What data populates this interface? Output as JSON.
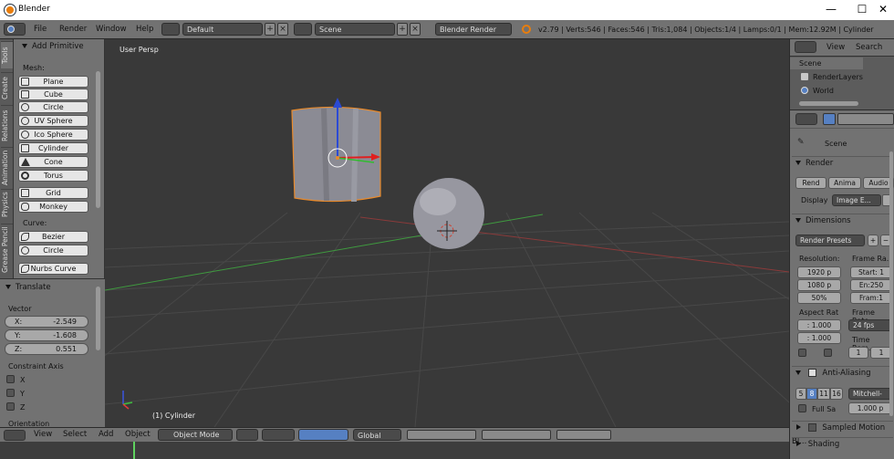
{
  "window": {
    "title": "Blender",
    "minimize": "—",
    "maximize": "☐",
    "close": "✕"
  },
  "infobar": {
    "menus": [
      "File",
      "Render",
      "Window",
      "Help"
    ],
    "layout": "Default",
    "scene": "Scene",
    "engine": "Blender Render",
    "stats": "v2.79 | Verts:546 | Faces:546 | Tris:1,084 | Objects:1/4 | Lamps:0/1 | Mem:12.92M | Cylinder"
  },
  "toolshelf": {
    "tabs": [
      "Tools",
      "Create",
      "Relations",
      "Animation",
      "Physics",
      "Grease Pencil"
    ],
    "panel_title": "Add Primitive",
    "mesh_label": "Mesh:",
    "mesh_items": [
      "Plane",
      "Cube",
      "Circle",
      "UV Sphere",
      "Ico Sphere",
      "Cylinder",
      "Cone",
      "Torus",
      "Grid",
      "Monkey"
    ],
    "curve_label": "Curve:",
    "curve_items": [
      "Bezier",
      "Circle",
      "Nurbs Curve"
    ]
  },
  "operator": {
    "title": "Translate",
    "vector_label": "Vector",
    "x": "X:",
    "x_val": "-2.549",
    "y": "Y:",
    "y_val": "-1.608",
    "z": "Z:",
    "z_val": "0.551",
    "constraint_label": "Constraint Axis",
    "cx": "X",
    "cy": "Y",
    "cz": "Z",
    "orientation": "Orientation"
  },
  "viewport": {
    "view_label": "User Persp",
    "object_label": "(1) Cylinder"
  },
  "bottombar": {
    "menus": [
      "View",
      "Select",
      "Add",
      "Object"
    ],
    "mode": "Object Mode",
    "orientation": "Global"
  },
  "outliner": {
    "view": "View",
    "search": "Search",
    "items": [
      "Scene",
      "RenderLayers",
      "World"
    ]
  },
  "properties": {
    "context": "Scene",
    "render_header": "Render",
    "render_btns": [
      "Rend",
      "Anima",
      "Audio"
    ],
    "display_label": "Display",
    "display_value": "Image E...",
    "dimensions_header": "Dimensions",
    "presets": "Render Presets",
    "resolution_label": "Resolution:",
    "res_x": "1920 p",
    "res_y": "1080 p",
    "res_pct": "50%",
    "frame_range_label": "Frame Ra...",
    "start": "Start: 1",
    "end": "En:250",
    "frame": "Fram:1",
    "aspect_label": "Aspect Rat",
    "aspect_x": ": 1.000",
    "aspect_y": ": 1.000",
    "frame_rate_label": "Frame Rate:",
    "fps": "24 fps",
    "time_remap": "Time Rem...",
    "time_val1": "1",
    "time_val2": "1",
    "aa_header": "Anti-Aliasing",
    "aa_samples": [
      "5",
      "8",
      "11",
      "16"
    ],
    "aa_filter": "Mitchell-",
    "full_sample": "Full Sa",
    "filter_size": "1.000 p",
    "sampled_motion": "Sampled Motion Bl...",
    "shading": "Shading",
    "accent": "#5680c2"
  }
}
